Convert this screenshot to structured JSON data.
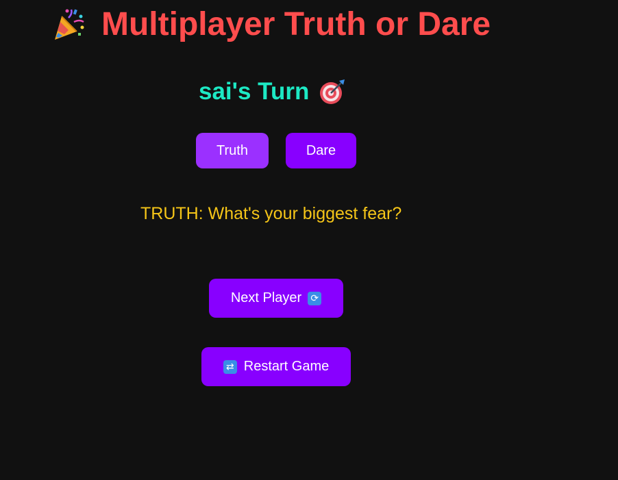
{
  "header": {
    "icon": "party-popper-icon",
    "title": "Multiplayer Truth or Dare"
  },
  "turn": {
    "text": "sai's Turn",
    "icon": "direct-hit-target-icon"
  },
  "choices": {
    "truth_label": "Truth",
    "dare_label": "Dare"
  },
  "prompt": {
    "text": "TRUTH: What's your biggest fear?"
  },
  "actions": {
    "next_label": "Next Player",
    "next_icon": "counterclockwise-arrows-icon",
    "restart_label": "Restart Game",
    "restart_icon": "repeat-icon"
  },
  "colors": {
    "background": "#111111",
    "title": "#ff4d4d",
    "turn": "#1de9c4",
    "prompt": "#f5c518",
    "truth_button": "#9b30ff",
    "primary_button": "#8800ff",
    "icon_blue": "#3a8ee6"
  }
}
